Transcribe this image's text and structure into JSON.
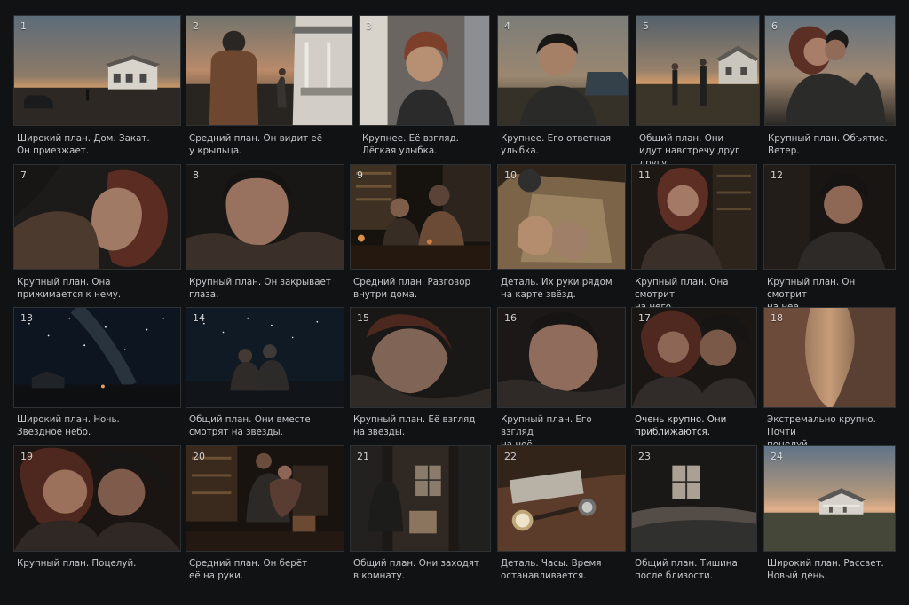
{
  "storyboard": {
    "frames": [
      {
        "number": "1",
        "caption": "Широкий план. Дом. Закат.\nОн приезжает."
      },
      {
        "number": "2",
        "caption": "Средний план. Он видит её\nу крыльца."
      },
      {
        "number": "3",
        "caption": "Крупнее. Её взгляд.\nЛёгкая улыбка."
      },
      {
        "number": "4",
        "caption": "Крупнее. Его ответная\nулыбка."
      },
      {
        "number": "5",
        "caption": "Общий план. Они\nидут навстречу друг другу."
      },
      {
        "number": "6",
        "caption": "Крупный план. Объятие.\nВетер."
      },
      {
        "number": "7",
        "caption": "Крупный план. Она\nприжимается к нему."
      },
      {
        "number": "8",
        "caption": "Крупный план. Он закрывает\nглаза."
      },
      {
        "number": "9",
        "caption": "Средний план. Разговор\nвнутри дома."
      },
      {
        "number": "10",
        "caption": "Деталь. Их руки рядом\nна карте звёзд."
      },
      {
        "number": "11",
        "caption": "Крупный план. Она смотрит\nна него."
      },
      {
        "number": "12",
        "caption": "Крупный план. Он смотрит\nна неё."
      },
      {
        "number": "13",
        "caption": "Широкий план. Ночь.\nЗвёздное небо."
      },
      {
        "number": "14",
        "caption": "Общий план. Они вместе\nсмотрят на звёзды."
      },
      {
        "number": "15",
        "caption": "Крупный план. Её взгляд\nна звёзды."
      },
      {
        "number": "16",
        "caption": "Крупный план. Его взгляд\nна неё."
      },
      {
        "number": "17",
        "caption": "Очень крупно. Они\nприближаются."
      },
      {
        "number": "18",
        "caption": "Экстремально крупно. Почти\nпоцелуй."
      },
      {
        "number": "19",
        "caption": "Крупный план. Поцелуй."
      },
      {
        "number": "20",
        "caption": "Средний план. Он берёт\nеё на руки."
      },
      {
        "number": "21",
        "caption": "Общий план. Они заходят\nв комнату."
      },
      {
        "number": "22",
        "caption": "Деталь. Часы. Время\nостанавливается."
      },
      {
        "number": "23",
        "caption": "Общий план. Тишина\nпосле близости."
      },
      {
        "number": "24",
        "caption": "Широкий план. Рассвет.\nНовый день."
      }
    ]
  }
}
